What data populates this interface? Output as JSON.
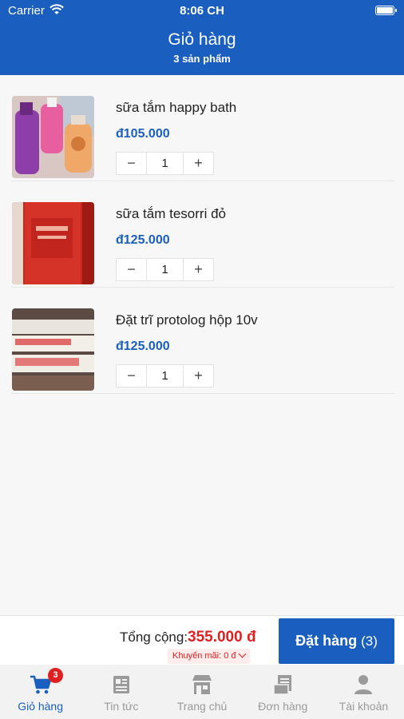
{
  "status_bar": {
    "carrier": "Carrier",
    "time": "8:06 CH"
  },
  "header": {
    "title": "Giỏ hàng",
    "subtitle": "3 sản phẩm"
  },
  "cart": {
    "items": [
      {
        "name": "sữa tắm happy bath",
        "price": "đ105.000",
        "quantity": "1",
        "image": "product-photo-bottles"
      },
      {
        "name": "sữa tắm tesorri đỏ",
        "price": "đ125.000",
        "quantity": "1",
        "image": "product-photo-red-bottle"
      },
      {
        "name": "Đặt trĩ protolog hộp 10v",
        "price": "đ125.000",
        "quantity": "1",
        "image": "product-photo-boxes"
      }
    ],
    "minus_symbol": "−",
    "plus_symbol": "+"
  },
  "checkout": {
    "total_label": "Tổng cộng:",
    "total_value": "355.000 đ",
    "promo_label": "Khuyến mãi: 0 đ",
    "order_button_label": "Đặt hàng",
    "order_button_count": "(3)"
  },
  "tabbar": {
    "badge": "3",
    "tabs": [
      {
        "label": "Giỏ hàng",
        "icon": "cart-icon",
        "active": true
      },
      {
        "label": "Tin tức",
        "icon": "news-icon",
        "active": false
      },
      {
        "label": "Trang chủ",
        "icon": "store-icon",
        "active": false
      },
      {
        "label": "Đơn hàng",
        "icon": "orders-icon",
        "active": false
      },
      {
        "label": "Tài khoản",
        "icon": "account-icon",
        "active": false
      }
    ]
  },
  "colors": {
    "primary": "#1a5fbf",
    "accent_red": "#e02020",
    "inactive": "#9a9a9a"
  }
}
